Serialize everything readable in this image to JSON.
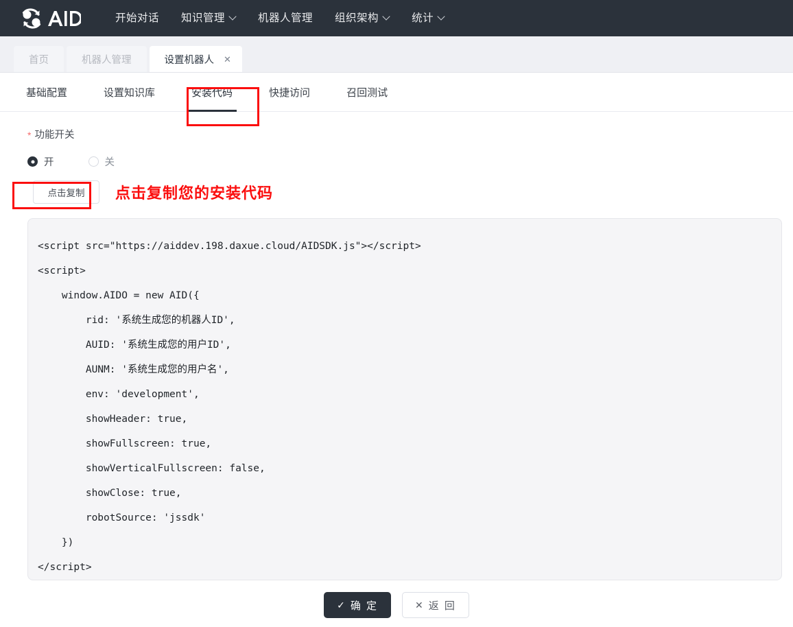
{
  "header": {
    "logo_text": "AID",
    "logo_icon": "aid-circular-arrows-logo",
    "nav": [
      {
        "label": "开始对话",
        "has_dropdown": false
      },
      {
        "label": "知识管理",
        "has_dropdown": true
      },
      {
        "label": "机器人管理",
        "has_dropdown": false
      },
      {
        "label": "组织架构",
        "has_dropdown": true
      },
      {
        "label": "统计",
        "has_dropdown": true
      }
    ],
    "background_color": "#2b323b"
  },
  "tabstrip": {
    "tabs": [
      {
        "label": "首页",
        "active": false,
        "closable": false
      },
      {
        "label": "机器人管理",
        "active": false,
        "closable": false
      },
      {
        "label": "设置机器人",
        "active": true,
        "closable": true
      }
    ],
    "close_icon": "✕"
  },
  "subtabs": {
    "items": [
      {
        "label": "基础配置",
        "active": false
      },
      {
        "label": "设置知识库",
        "active": false
      },
      {
        "label": "安装代码",
        "active": true
      },
      {
        "label": "快捷访问",
        "active": false
      },
      {
        "label": "召回测试",
        "active": false
      }
    ]
  },
  "form": {
    "required_marker": "*",
    "switch_label": "功能开关",
    "radios": [
      {
        "label": "开",
        "checked": true
      },
      {
        "label": "关",
        "checked": false
      }
    ],
    "copy_button_label": "点击复制"
  },
  "annotations": {
    "color": "#fb0e0e",
    "copy_hint_text": "点击复制您的安装代码",
    "highlight_boxes": [
      {
        "name": "install-code-tab-highlight",
        "target": "安装代码"
      },
      {
        "name": "copy-button-highlight",
        "target": "点击复制"
      }
    ]
  },
  "code_block": {
    "lines": [
      "<script src=\"https://aiddev.198.daxue.cloud/AIDSDK.js\"></script>",
      "<script>",
      "    window.AIDO = new AID({",
      "        rid: '系统生成您的机器人ID',",
      "        AUID: '系统生成您的用户ID',",
      "        AUNM: '系统生成您的用户名',",
      "        env: 'development',",
      "        showHeader: true,",
      "        showFullscreen: true,",
      "        showVerticalFullscreen: false,",
      "        showClose: true,",
      "        robotSource: 'jssdk'",
      "    })",
      "</script>"
    ]
  },
  "footer": {
    "confirm": {
      "label": "确 定",
      "icon": "✓"
    },
    "back": {
      "label": "返 回",
      "icon": "✕"
    }
  }
}
